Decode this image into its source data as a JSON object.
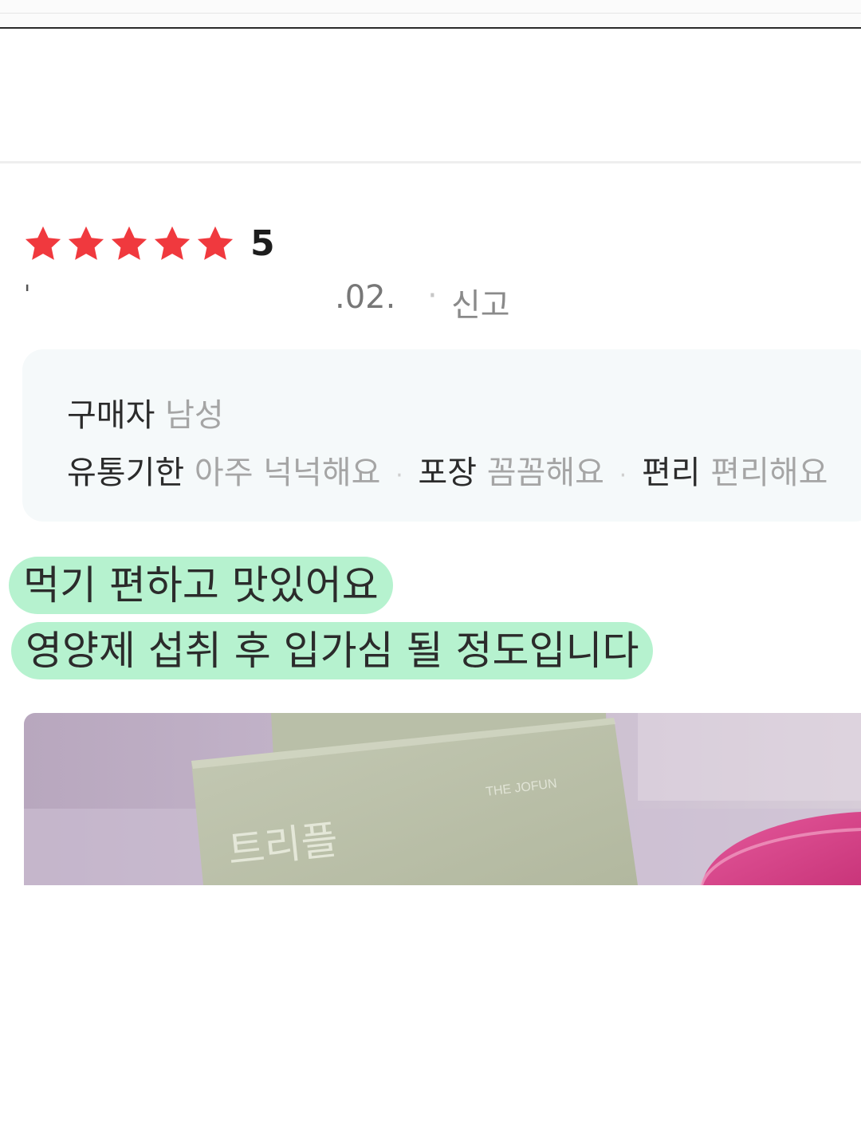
{
  "review": {
    "rating_value": "5",
    "stars_filled": 5,
    "star_color": "#f0393e",
    "meta": {
      "leading_mark": "'",
      "date_fragment": ".02.",
      "separator": "·",
      "report_label": "신고"
    },
    "survey": {
      "buyer_label": "구매자",
      "buyer_value": "남성",
      "items": [
        {
          "label": "유통기한",
          "value": "아주 넉넉해요"
        },
        {
          "label": "포장",
          "value": "꼼꼼해요"
        },
        {
          "label": "편리",
          "value": "편리해요"
        }
      ],
      "separator": "·"
    },
    "body_lines": [
      "먹기 편하고 맛있어요",
      "영양제 섭취 후 입가심 될 정도입니다"
    ],
    "highlight_color": "#b6f2cf",
    "photo": {
      "product_title": "트리플",
      "brand": "THE JOFUN"
    }
  }
}
